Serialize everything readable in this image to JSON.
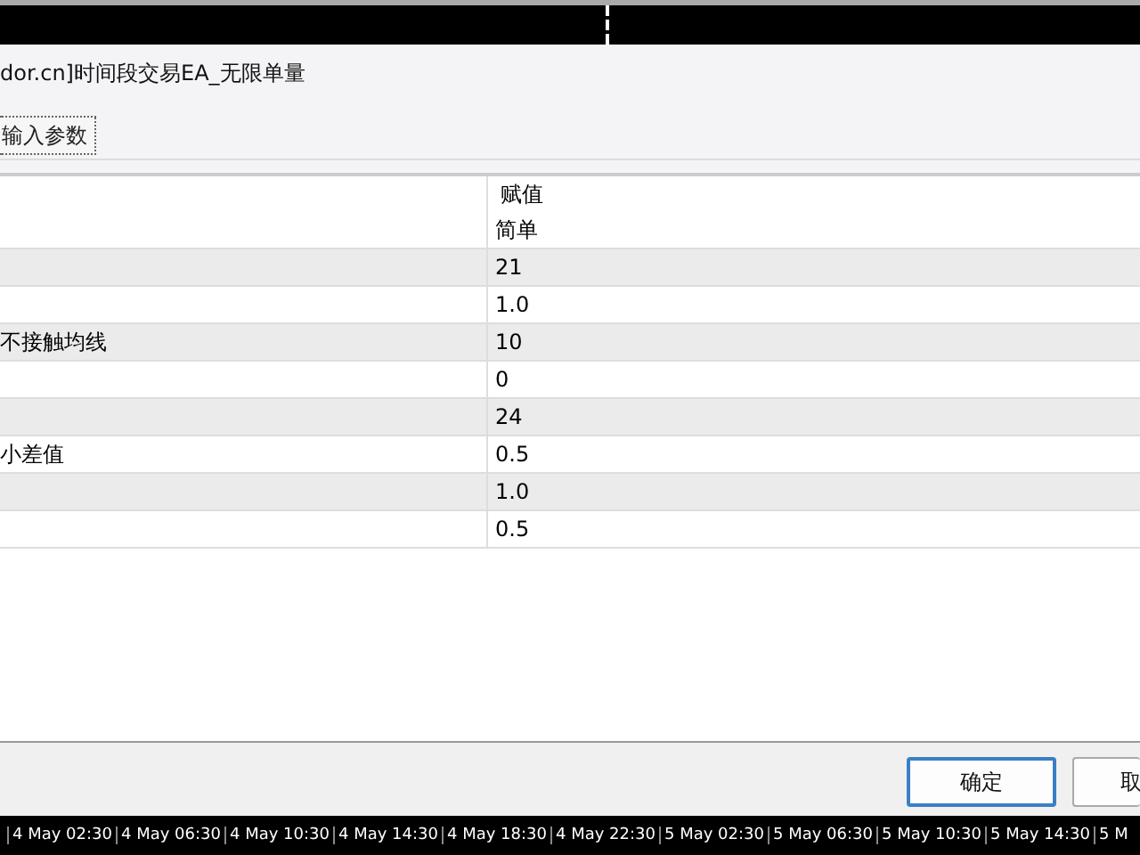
{
  "window": {
    "title": "dor.cn]时间段交易EA_无限单量"
  },
  "tabs": [
    {
      "label": "输入参数"
    }
  ],
  "table": {
    "value_header": "赋值",
    "rows": [
      {
        "column_1": "",
        "value": "简单"
      },
      {
        "column_1": "",
        "value": "21"
      },
      {
        "column_1": "",
        "value": "1.0"
      },
      {
        "column_1": "不接触均线",
        "value": "10"
      },
      {
        "column_1": "",
        "value": "0"
      },
      {
        "column_1": "",
        "value": "24"
      },
      {
        "column_1": "小差值",
        "value": "0.5"
      },
      {
        "column_1": "",
        "value": "1.0"
      },
      {
        "column_1": "",
        "value": "0.5"
      }
    ]
  },
  "buttons": [
    {
      "label": "确定",
      "kind": "default"
    },
    {
      "label": "取",
      "kind": "plain"
    }
  ],
  "timeline": [
    "4 May 02:30",
    "4 May 06:30",
    "4 May 10:30",
    "4 May 14:30",
    "4 May 18:30",
    "4 May 22:30",
    "5 May 02:30",
    "5 May 06:30",
    "5 May 10:30",
    "5 May 14:30",
    "5 M"
  ]
}
